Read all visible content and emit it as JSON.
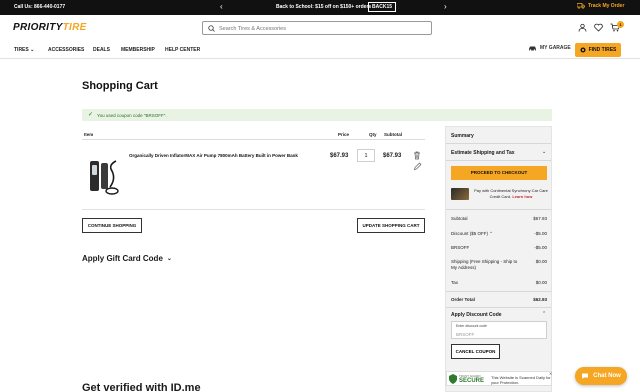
{
  "topbar": {
    "call": "Call Us: 866-440-0177",
    "promo": "Back to School: $15 off on $150+ orders",
    "promo_code": "BACK15",
    "track_order": "Track My Order"
  },
  "header": {
    "logo_priority": "PRIORITY",
    "logo_tire": "TIRE",
    "search_placeholder": "Search Tires & Accessories",
    "cart_count": "1"
  },
  "nav": {
    "items": [
      "TIRES",
      "ACCESSORIES",
      "DEALS",
      "MEMBERSHIP",
      "HELP CENTER"
    ],
    "my_garage": "MY GARAGE",
    "find_tires": "FIND TIRES"
  },
  "page": {
    "title": "Shopping Cart",
    "alert": "You used coupon code \"BRSOFF\".",
    "table_headers": {
      "item": "Item",
      "price": "Price",
      "qty": "Qty",
      "subtotal": "Subtotal"
    },
    "product": {
      "name": "Organically Driven InflatorMAX Air Pump 7800mAh Battery Built in Power Bank",
      "price": "$67.93",
      "qty": "1",
      "subtotal": "$67.93"
    },
    "continue_shopping": "CONTINUE SHOPPING",
    "update_cart": "UPDATE SHOPPING CART",
    "gift_card": "Apply Gift Card Code",
    "verify": "Get verified with ID.me"
  },
  "summary": {
    "title": "Summary",
    "estimate": "Estimate Shipping and Tax",
    "checkout": "PROCEED TO CHECKOUT",
    "card_text": "Pay with Continental Synchrony Car Care Credit Card.",
    "learn_more": "Learn how",
    "rows": [
      {
        "label": "Subtotal",
        "value": "$67.93"
      },
      {
        "label": "Discount ($5 OFF)",
        "value": "-$5.00"
      },
      {
        "label": "BRSOFF",
        "value": "-$5.00"
      },
      {
        "label": "Shipping (Free Shipping - Ship to My Address)",
        "value": "$0.00"
      },
      {
        "label": "Tax",
        "value": "$0.00"
      },
      {
        "label": "Order Total",
        "value": "$62.93"
      }
    ],
    "discount_title": "Apply Discount Code",
    "discount_label": "Enter discount code",
    "discount_value": "BRSOFF",
    "cancel_coupon": "CANCEL COUPON"
  },
  "secure_badge": {
    "trusted": "TRUST GUARD",
    "secure": "SECURE",
    "note": "This Website is Scanned Daily for your Protection."
  },
  "chat": {
    "label": "Chat Now"
  },
  "colors": {
    "accent": "#f5a623",
    "topbar": "#111111",
    "success_bg": "#e8f3e4"
  }
}
